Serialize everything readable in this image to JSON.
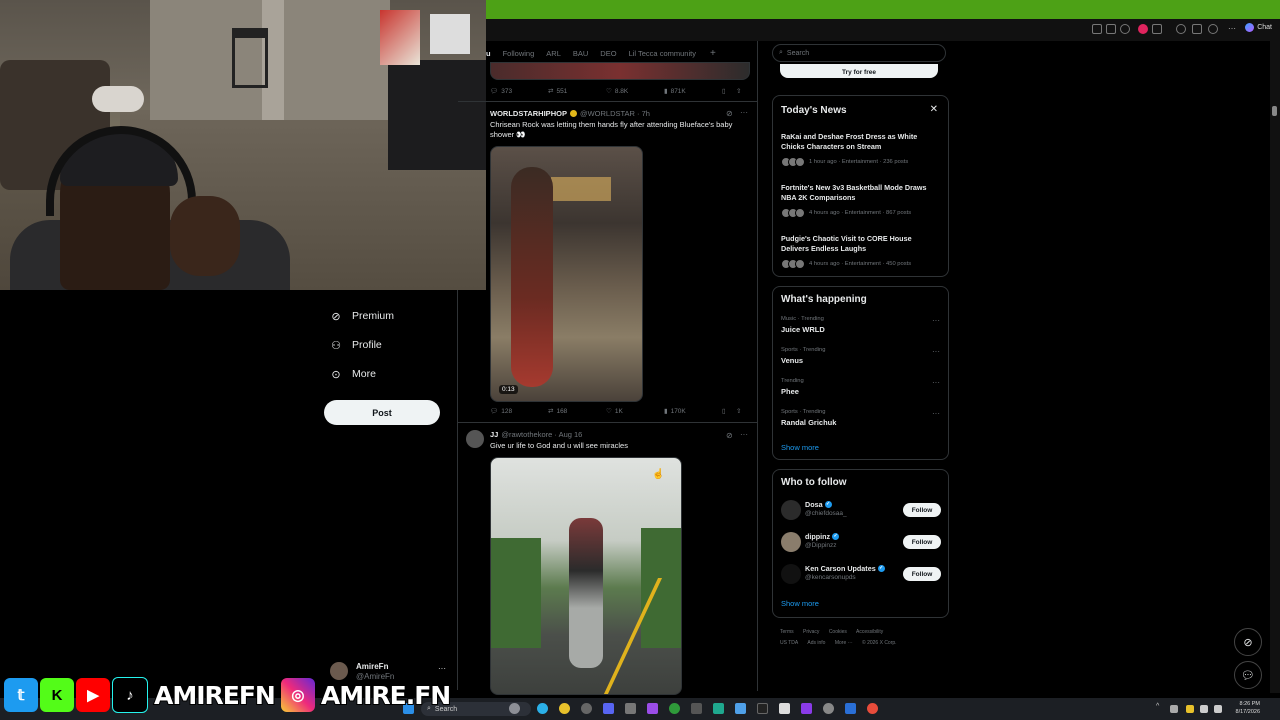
{
  "browser": {
    "chat_label": "Chat"
  },
  "nav": {
    "items": [
      {
        "label": "Premium",
        "icon": "premium-icon"
      },
      {
        "label": "Profile",
        "icon": "profile-icon"
      },
      {
        "label": "More",
        "icon": "more-circle-icon"
      }
    ],
    "post_label": "Post",
    "account_name": "AmireFn",
    "account_handle": "@AmireFn"
  },
  "feed": {
    "tabs": [
      "Following",
      "ARL",
      "BAU",
      "DEO",
      "Lil Tecca community"
    ],
    "tab_add": "+",
    "top_actions": {
      "replies": "373",
      "reposts": "551",
      "likes": "8.8K",
      "views": "871K"
    },
    "tweets": [
      {
        "author": "WORLDSTARHIPHOP",
        "handle": "@WORLDSTAR · 7h",
        "text": "Chrisean Rock was letting them hands fly after attending Blueface's baby shower 👀",
        "duration": "0:13",
        "actions": {
          "replies": "128",
          "reposts": "168",
          "likes": "1K",
          "views": "170K"
        }
      },
      {
        "author": "JJ",
        "handle": "@rawtothekore · Aug 16",
        "text": "Give ur life to God and u will see miracles"
      }
    ]
  },
  "sidebar": {
    "search_placeholder": "Search",
    "promo_label": "Try for free",
    "news": {
      "title": "Today's News",
      "items": [
        {
          "title": "RaKai and Deshae Frost Dress as White Chicks Characters on Stream",
          "meta": "1 hour ago · Entertainment · 236 posts"
        },
        {
          "title": "Fortnite's New 3v3 Basketball Mode Draws NBA 2K Comparisons",
          "meta": "4 hours ago · Entertainment · 867 posts"
        },
        {
          "title": "Pudgie's Chaotic Visit to CORE House Delivers Endless Laughs",
          "meta": "4 hours ago · Entertainment · 450 posts"
        }
      ]
    },
    "happening": {
      "title": "What's happening",
      "trends": [
        {
          "category": "Music · Trending",
          "name": "Juice WRLD"
        },
        {
          "category": "Sports · Trending",
          "name": "Venus"
        },
        {
          "category": "Trending",
          "name": "Phee"
        },
        {
          "category": "Sports · Trending",
          "name": "Randal Grichuk"
        }
      ],
      "show_more": "Show more"
    },
    "who_to_follow": {
      "title": "Who to follow",
      "users": [
        {
          "name": "Dosa",
          "handle": "@chiefdosaa_",
          "button": "Follow"
        },
        {
          "name": "dippinz",
          "handle": "@Dippinzz",
          "button": "Follow"
        },
        {
          "name": "Ken Carson Updates",
          "handle": "@kencarsonupds",
          "button": "Follow"
        }
      ],
      "show_more": "Show more"
    },
    "footer": [
      "Terms",
      "Privacy",
      "Cookies",
      "Accessibility",
      "US TDA",
      "Ads info",
      "More ···",
      "© 2026 X Corp."
    ]
  },
  "taskbar": {
    "search_label": "Search",
    "time": "8:26 PM",
    "date": "8/17/2026"
  },
  "overlay": {
    "name1": "AMIREFN",
    "name2": "AMIRE.FN"
  }
}
